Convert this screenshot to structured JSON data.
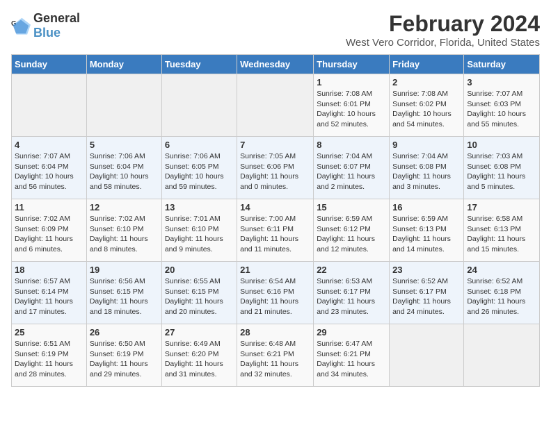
{
  "header": {
    "logo_general": "General",
    "logo_blue": "Blue",
    "main_title": "February 2024",
    "subtitle": "West Vero Corridor, Florida, United States"
  },
  "days_of_week": [
    "Sunday",
    "Monday",
    "Tuesday",
    "Wednesday",
    "Thursday",
    "Friday",
    "Saturday"
  ],
  "weeks": [
    [
      {
        "day": "",
        "empty": true
      },
      {
        "day": "",
        "empty": true
      },
      {
        "day": "",
        "empty": true
      },
      {
        "day": "",
        "empty": true
      },
      {
        "day": "1",
        "sunrise": "7:08 AM",
        "sunset": "6:01 PM",
        "daylight": "10 hours and 52 minutes."
      },
      {
        "day": "2",
        "sunrise": "7:08 AM",
        "sunset": "6:02 PM",
        "daylight": "10 hours and 54 minutes."
      },
      {
        "day": "3",
        "sunrise": "7:07 AM",
        "sunset": "6:03 PM",
        "daylight": "10 hours and 55 minutes."
      }
    ],
    [
      {
        "day": "4",
        "sunrise": "7:07 AM",
        "sunset": "6:04 PM",
        "daylight": "10 hours and 56 minutes."
      },
      {
        "day": "5",
        "sunrise": "7:06 AM",
        "sunset": "6:04 PM",
        "daylight": "10 hours and 58 minutes."
      },
      {
        "day": "6",
        "sunrise": "7:06 AM",
        "sunset": "6:05 PM",
        "daylight": "10 hours and 59 minutes."
      },
      {
        "day": "7",
        "sunrise": "7:05 AM",
        "sunset": "6:06 PM",
        "daylight": "11 hours and 0 minutes."
      },
      {
        "day": "8",
        "sunrise": "7:04 AM",
        "sunset": "6:07 PM",
        "daylight": "11 hours and 2 minutes."
      },
      {
        "day": "9",
        "sunrise": "7:04 AM",
        "sunset": "6:08 PM",
        "daylight": "11 hours and 3 minutes."
      },
      {
        "day": "10",
        "sunrise": "7:03 AM",
        "sunset": "6:08 PM",
        "daylight": "11 hours and 5 minutes."
      }
    ],
    [
      {
        "day": "11",
        "sunrise": "7:02 AM",
        "sunset": "6:09 PM",
        "daylight": "11 hours and 6 minutes."
      },
      {
        "day": "12",
        "sunrise": "7:02 AM",
        "sunset": "6:10 PM",
        "daylight": "11 hours and 8 minutes."
      },
      {
        "day": "13",
        "sunrise": "7:01 AM",
        "sunset": "6:10 PM",
        "daylight": "11 hours and 9 minutes."
      },
      {
        "day": "14",
        "sunrise": "7:00 AM",
        "sunset": "6:11 PM",
        "daylight": "11 hours and 11 minutes."
      },
      {
        "day": "15",
        "sunrise": "6:59 AM",
        "sunset": "6:12 PM",
        "daylight": "11 hours and 12 minutes."
      },
      {
        "day": "16",
        "sunrise": "6:59 AM",
        "sunset": "6:13 PM",
        "daylight": "11 hours and 14 minutes."
      },
      {
        "day": "17",
        "sunrise": "6:58 AM",
        "sunset": "6:13 PM",
        "daylight": "11 hours and 15 minutes."
      }
    ],
    [
      {
        "day": "18",
        "sunrise": "6:57 AM",
        "sunset": "6:14 PM",
        "daylight": "11 hours and 17 minutes."
      },
      {
        "day": "19",
        "sunrise": "6:56 AM",
        "sunset": "6:15 PM",
        "daylight": "11 hours and 18 minutes."
      },
      {
        "day": "20",
        "sunrise": "6:55 AM",
        "sunset": "6:15 PM",
        "daylight": "11 hours and 20 minutes."
      },
      {
        "day": "21",
        "sunrise": "6:54 AM",
        "sunset": "6:16 PM",
        "daylight": "11 hours and 21 minutes."
      },
      {
        "day": "22",
        "sunrise": "6:53 AM",
        "sunset": "6:17 PM",
        "daylight": "11 hours and 23 minutes."
      },
      {
        "day": "23",
        "sunrise": "6:52 AM",
        "sunset": "6:17 PM",
        "daylight": "11 hours and 24 minutes."
      },
      {
        "day": "24",
        "sunrise": "6:52 AM",
        "sunset": "6:18 PM",
        "daylight": "11 hours and 26 minutes."
      }
    ],
    [
      {
        "day": "25",
        "sunrise": "6:51 AM",
        "sunset": "6:19 PM",
        "daylight": "11 hours and 28 minutes."
      },
      {
        "day": "26",
        "sunrise": "6:50 AM",
        "sunset": "6:19 PM",
        "daylight": "11 hours and 29 minutes."
      },
      {
        "day": "27",
        "sunrise": "6:49 AM",
        "sunset": "6:20 PM",
        "daylight": "11 hours and 31 minutes."
      },
      {
        "day": "28",
        "sunrise": "6:48 AM",
        "sunset": "6:21 PM",
        "daylight": "11 hours and 32 minutes."
      },
      {
        "day": "29",
        "sunrise": "6:47 AM",
        "sunset": "6:21 PM",
        "daylight": "11 hours and 34 minutes."
      },
      {
        "day": "",
        "empty": true
      },
      {
        "day": "",
        "empty": true
      }
    ]
  ]
}
